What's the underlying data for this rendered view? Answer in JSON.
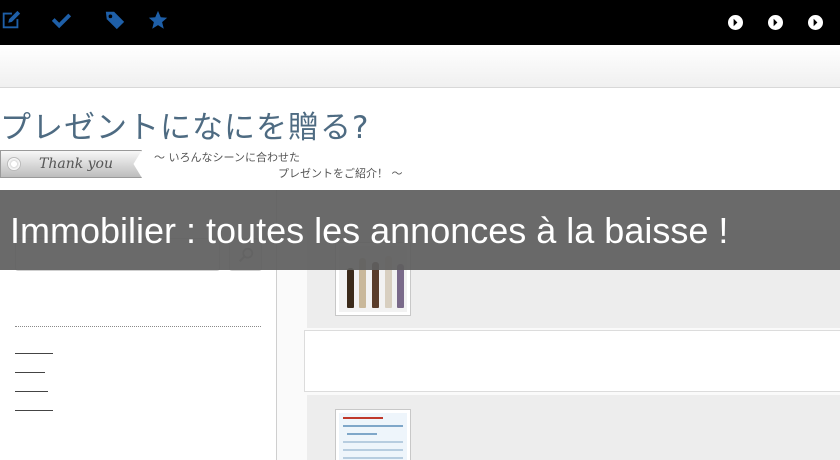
{
  "toolbar": {
    "icons": [
      "edit-icon",
      "check-icon",
      "tag-icon",
      "star-icon"
    ],
    "nav_arrows": [
      "arrow-right-icon",
      "arrow-right-icon",
      "arrow-right-icon"
    ]
  },
  "hero": {
    "title": "プレゼントになにを贈る?",
    "ribbon_text": "Thank you",
    "subtitle_line1": "～ いろんなシーンに合わせた",
    "subtitle_line2": "プレゼントをご紹介！ ～"
  },
  "overlay": {
    "title": "Immobilier : toutes les annonces à la baisse !"
  },
  "colors": {
    "topbar": "#000000",
    "icon_blue": "#1e5fa8",
    "hero_title": "#4e6b82",
    "overlay_bg": "#5f5f5f"
  }
}
